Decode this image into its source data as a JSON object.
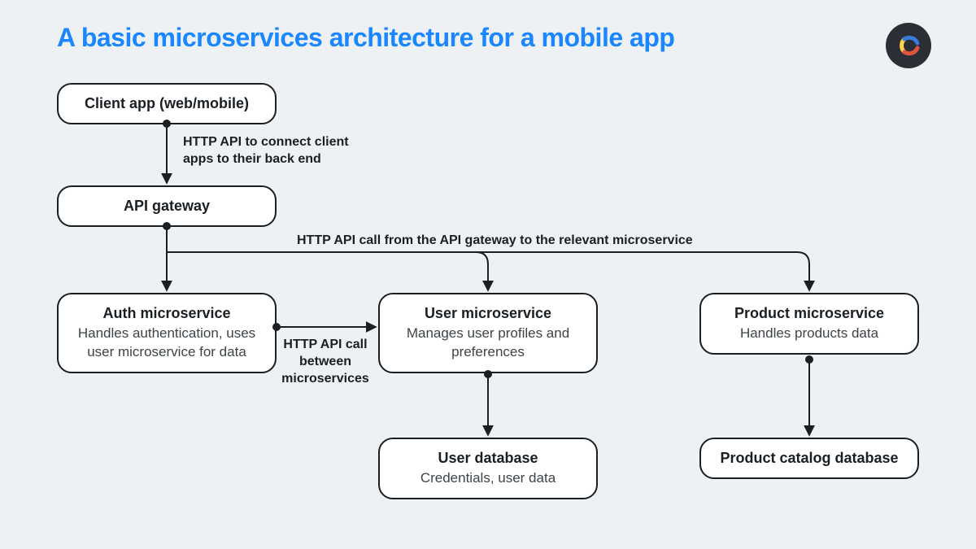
{
  "title": "A basic microservices architecture for a mobile app",
  "nodes": {
    "client": {
      "title": "Client app (web/mobile)"
    },
    "gateway": {
      "title": "API gateway"
    },
    "auth": {
      "title": "Auth microservice",
      "sub": "Handles authentication, uses user microservice for data"
    },
    "user": {
      "title": "User microservice",
      "sub": "Manages user profiles and preferences"
    },
    "product": {
      "title": "Product microservice",
      "sub": "Handles products data"
    },
    "userdb": {
      "title": "User database",
      "sub": "Credentials, user data"
    },
    "proddb": {
      "title": "Product catalog database"
    }
  },
  "edges": {
    "client_to_gateway": "HTTP API to connect client apps to their back end",
    "gateway_fanout": "HTTP API call from the API gateway to the relevant microservice",
    "auth_to_user": "HTTP API call between microservices"
  },
  "colors": {
    "accent": "#1a86ff",
    "stroke": "#1a1f23",
    "bg": "#eef1f4"
  }
}
